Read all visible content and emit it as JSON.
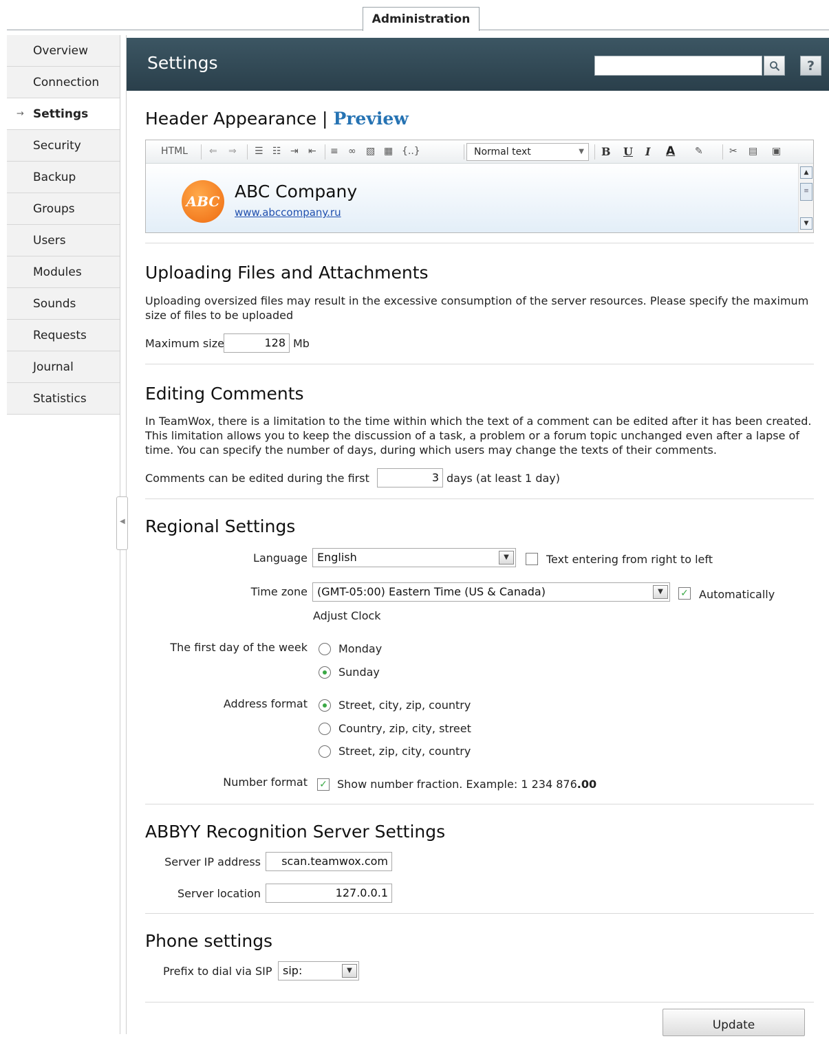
{
  "top_tab": "Administration",
  "sidebar": {
    "items": [
      {
        "label": "Overview"
      },
      {
        "label": "Connection"
      },
      {
        "label": "Settings",
        "active": true
      },
      {
        "label": "Security"
      },
      {
        "label": "Backup"
      },
      {
        "label": "Groups"
      },
      {
        "label": "Users"
      },
      {
        "label": "Modules"
      },
      {
        "label": "Sounds"
      },
      {
        "label": "Requests"
      },
      {
        "label": "Journal"
      },
      {
        "label": "Statistics"
      }
    ]
  },
  "header": {
    "title": "Settings",
    "search_value": "",
    "search_icon": "magnifier-icon",
    "help_label": "?"
  },
  "header_appearance": {
    "title": "Header Appearance",
    "separator": "|",
    "preview_link": "Preview",
    "toolbar": {
      "html_label": "HTML",
      "text_style": "Normal text",
      "bold": "B",
      "underline": "U",
      "italic": "I",
      "font_color": "A",
      "code": "{..}"
    },
    "company_logo_text": "ABC",
    "company_name": "ABC Company",
    "company_url": "www.abccompany.ru"
  },
  "uploading": {
    "title": "Uploading Files and Attachments",
    "description": "Uploading oversized files may result in the excessive consumption of the server resources. Please specify the maximum size of files to be uploaded",
    "max_size_label": "Maximum size",
    "max_size_value": "128",
    "unit": "Mb"
  },
  "editing": {
    "title": "Editing Comments",
    "description": "In TeamWox, there is a limitation to the time within which the text of a comment can be edited after it has been created. This limitation allows you to keep the discussion of a task, a problem or a forum topic unchanged even after a lapse of time. You can specify the number of days, during which users may change the texts of their comments.",
    "days_label": "Comments can be edited during the first",
    "days_value": "3",
    "days_suffix": "days (at least 1 day)"
  },
  "regional": {
    "title": "Regional Settings",
    "language_label": "Language",
    "language_value": "English",
    "rtl_label": "Text entering from right to left",
    "rtl_checked": false,
    "timezone_label": "Time zone",
    "timezone_value": "(GMT-05:00) Eastern Time (US & Canada)",
    "auto_label": "Automatically",
    "auto_checked": true,
    "adjust_clock": "Adjust Clock",
    "first_day_label": "The first day of the week",
    "first_day_options": [
      "Monday",
      "Sunday"
    ],
    "first_day_selected": "Sunday",
    "address_label": "Address format",
    "address_options": [
      "Street, city, zip, country",
      "Country, zip, city, street",
      "Street, zip, city, country"
    ],
    "address_selected": "Street, city, zip, country",
    "number_label": "Number format",
    "number_option": "Show number fraction. Example: 1 234 876",
    "number_example_bold": ".00",
    "number_checked": true
  },
  "abbyy": {
    "title": "ABBYY Recognition Server Settings",
    "ip_label": "Server IP address",
    "ip_value": "scan.teamwox.com",
    "location_label": "Server location",
    "location_value": "127.0.0.1"
  },
  "phone": {
    "title": "Phone settings",
    "prefix_label": "Prefix to dial via SIP",
    "prefix_value": "sip:"
  },
  "update_button": "Update",
  "colors": {
    "header_bg": "#2f4653",
    "link": "#2673b3",
    "check_green": "#3aa845",
    "logo_orange": "#ee6a10"
  }
}
